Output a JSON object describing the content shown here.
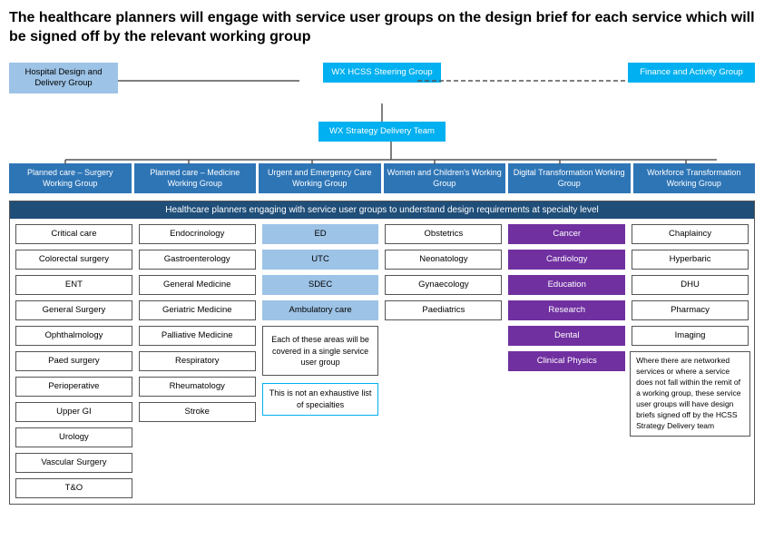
{
  "title": "The healthcare planners will engage with service user groups on the design brief for each service which will be signed off by the relevant working group",
  "org": {
    "hospital_box": "Hospital Design and Delivery Group",
    "steering_box": "WX HCSS Steering Group",
    "finance_box": "Finance and Activity Group",
    "strategy_box": "WX Strategy Delivery Team",
    "working_groups": [
      "Planned care – Surgery Working Group",
      "Planned care – Medicine Working Group",
      "Urgent and Emergency Care Working Group",
      "Women and Children's Working Group",
      "Digital Transformation Working Group",
      "Workforce Transformation Working Group"
    ]
  },
  "bottom_header": "Healthcare planners engaging with service user groups to understand design requirements at specialty level",
  "grid_cols": [
    {
      "cells": [
        {
          "text": "Critical care",
          "style": "white"
        },
        {
          "text": "Colorectal surgery",
          "style": "white"
        },
        {
          "text": "ENT",
          "style": "white"
        },
        {
          "text": "General Surgery",
          "style": "white"
        },
        {
          "text": "Ophthalmology",
          "style": "white"
        },
        {
          "text": "Paed surgery",
          "style": "white"
        },
        {
          "text": "Perioperative",
          "style": "white"
        },
        {
          "text": "Upper GI",
          "style": "white"
        },
        {
          "text": "Urology",
          "style": "white"
        },
        {
          "text": "Vascular Surgery",
          "style": "white"
        },
        {
          "text": "T&O",
          "style": "white"
        }
      ]
    },
    {
      "cells": [
        {
          "text": "Endocrinology",
          "style": "white"
        },
        {
          "text": "Gastroenterology",
          "style": "white"
        },
        {
          "text": "General Medicine",
          "style": "white"
        },
        {
          "text": "Geriatric Medicine",
          "style": "white"
        },
        {
          "text": "Palliative Medicine",
          "style": "white"
        },
        {
          "text": "Respiratory",
          "style": "white"
        },
        {
          "text": "Rheumatology",
          "style": "white"
        },
        {
          "text": "Stroke",
          "style": "white"
        }
      ]
    },
    {
      "cells": [
        {
          "text": "ED",
          "style": "blue"
        },
        {
          "text": "UTC",
          "style": "blue"
        },
        {
          "text": "SDEC",
          "style": "blue"
        },
        {
          "text": "Ambulatory care",
          "style": "blue"
        },
        {
          "text": "Each of these areas will be covered in a single service user group",
          "style": "note"
        },
        {
          "text": "This is not an exhaustive list of specialties",
          "style": "note2"
        }
      ]
    },
    {
      "cells": [
        {
          "text": "Obstetrics",
          "style": "white"
        },
        {
          "text": "Neonatology",
          "style": "white"
        },
        {
          "text": "Gynaecology",
          "style": "white"
        },
        {
          "text": "Paediatrics",
          "style": "white"
        }
      ]
    },
    {
      "cells": [
        {
          "text": "Cancer",
          "style": "purple"
        },
        {
          "text": "Cardiology",
          "style": "purple"
        },
        {
          "text": "Education",
          "style": "purple"
        },
        {
          "text": "Research",
          "style": "purple"
        },
        {
          "text": "Dental",
          "style": "purple"
        },
        {
          "text": "Clinical Physics",
          "style": "purple"
        }
      ]
    },
    {
      "cells": [
        {
          "text": "Chaplaincy",
          "style": "white"
        },
        {
          "text": "Hyperbaric",
          "style": "white"
        },
        {
          "text": "DHU",
          "style": "white"
        },
        {
          "text": "Pharmacy",
          "style": "white"
        },
        {
          "text": "Imaging",
          "style": "white"
        }
      ]
    }
  ],
  "note_text": "Where there are networked services or where a service does not fall within the remit of a working group, these service user groups will have design briefs signed off by the HCSS Strategy Delivery team"
}
